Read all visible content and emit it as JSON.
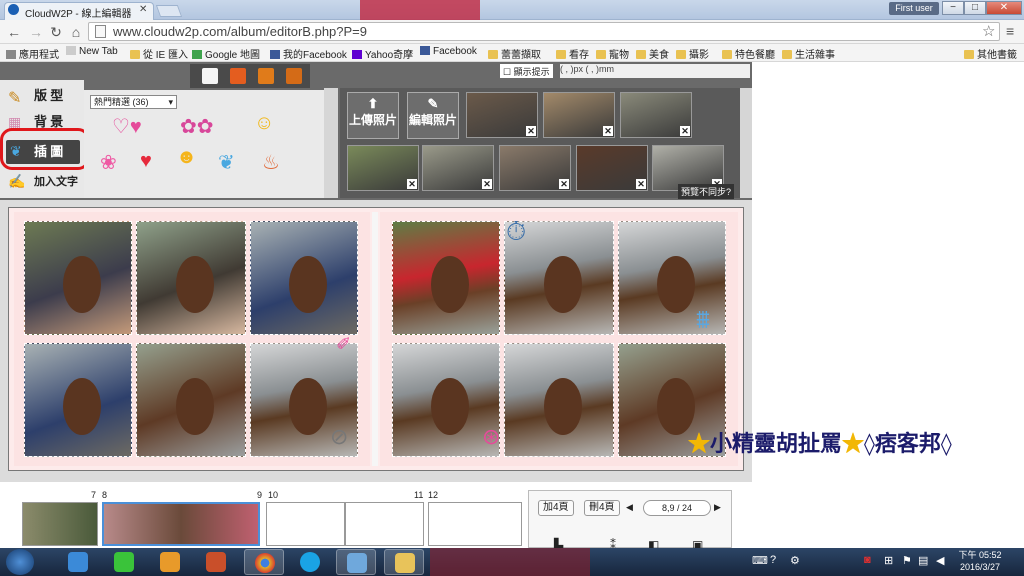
{
  "browser": {
    "tab_title": "CloudW2P - 線上編輯器",
    "user": "First user",
    "url": "www.cloudw2p.com/album/editorB.php?P=9",
    "win_min": "−",
    "win_max": "□",
    "win_close": "✕"
  },
  "bookmarks": [
    {
      "label": "應用程式",
      "icon": "apps-icon"
    },
    {
      "label": "New Tab",
      "icon": "page-icon"
    },
    {
      "label": "從 IE 匯入",
      "icon": "folder-icon"
    },
    {
      "label": "Google 地圖",
      "icon": "maps-icon"
    },
    {
      "label": "我的Facebook",
      "icon": "facebook-icon"
    },
    {
      "label": "Yahoo奇摩",
      "icon": "yahoo-icon"
    },
    {
      "label": "Facebook",
      "icon": "facebook-icon"
    },
    {
      "label": "蕾蕾擷取",
      "icon": "folder-icon"
    },
    {
      "label": "看存",
      "icon": "folder-icon"
    },
    {
      "label": "寵物",
      "icon": "folder-icon"
    },
    {
      "label": "美食",
      "icon": "folder-icon"
    },
    {
      "label": "攝影",
      "icon": "folder-icon"
    },
    {
      "label": "特色餐廳",
      "icon": "folder-icon"
    },
    {
      "label": "生活雜事",
      "icon": "folder-icon"
    },
    {
      "label": "其他書籤",
      "icon": "folder-icon"
    }
  ],
  "editor": {
    "show_hint": "顯示提示",
    "dims": "(        ,        )px  (        ,        )mm",
    "menu": [
      {
        "label": "版 型",
        "icon": "layout-icon"
      },
      {
        "label": "背 景",
        "icon": "background-icon"
      },
      {
        "label": "插 圖",
        "icon": "bird-icon"
      },
      {
        "label": "加入文字",
        "icon": "text-icon"
      }
    ],
    "sticker_dropdown": "熱門精選 (36)",
    "upload_label": "上傳照片",
    "edit_label": "編輯照片",
    "sync_tip": "預覽不同步?",
    "remove_mark": "✕"
  },
  "pages": {
    "n7": "7",
    "n8": "8",
    "n9": "9",
    "n10": "10",
    "n11": "11",
    "n12": "12",
    "add_pages": "加4頁",
    "delete_pages": "刪4頁",
    "current": "8,9 / 24",
    "prev": "◀",
    "next": "▶"
  },
  "watermark": {
    "text_a": "小精靈胡扯罵",
    "text_b": "◊痞客邦◊",
    "star": "★"
  },
  "taskbar": {
    "time": "下午 05:52",
    "date": "2016/3/27"
  }
}
